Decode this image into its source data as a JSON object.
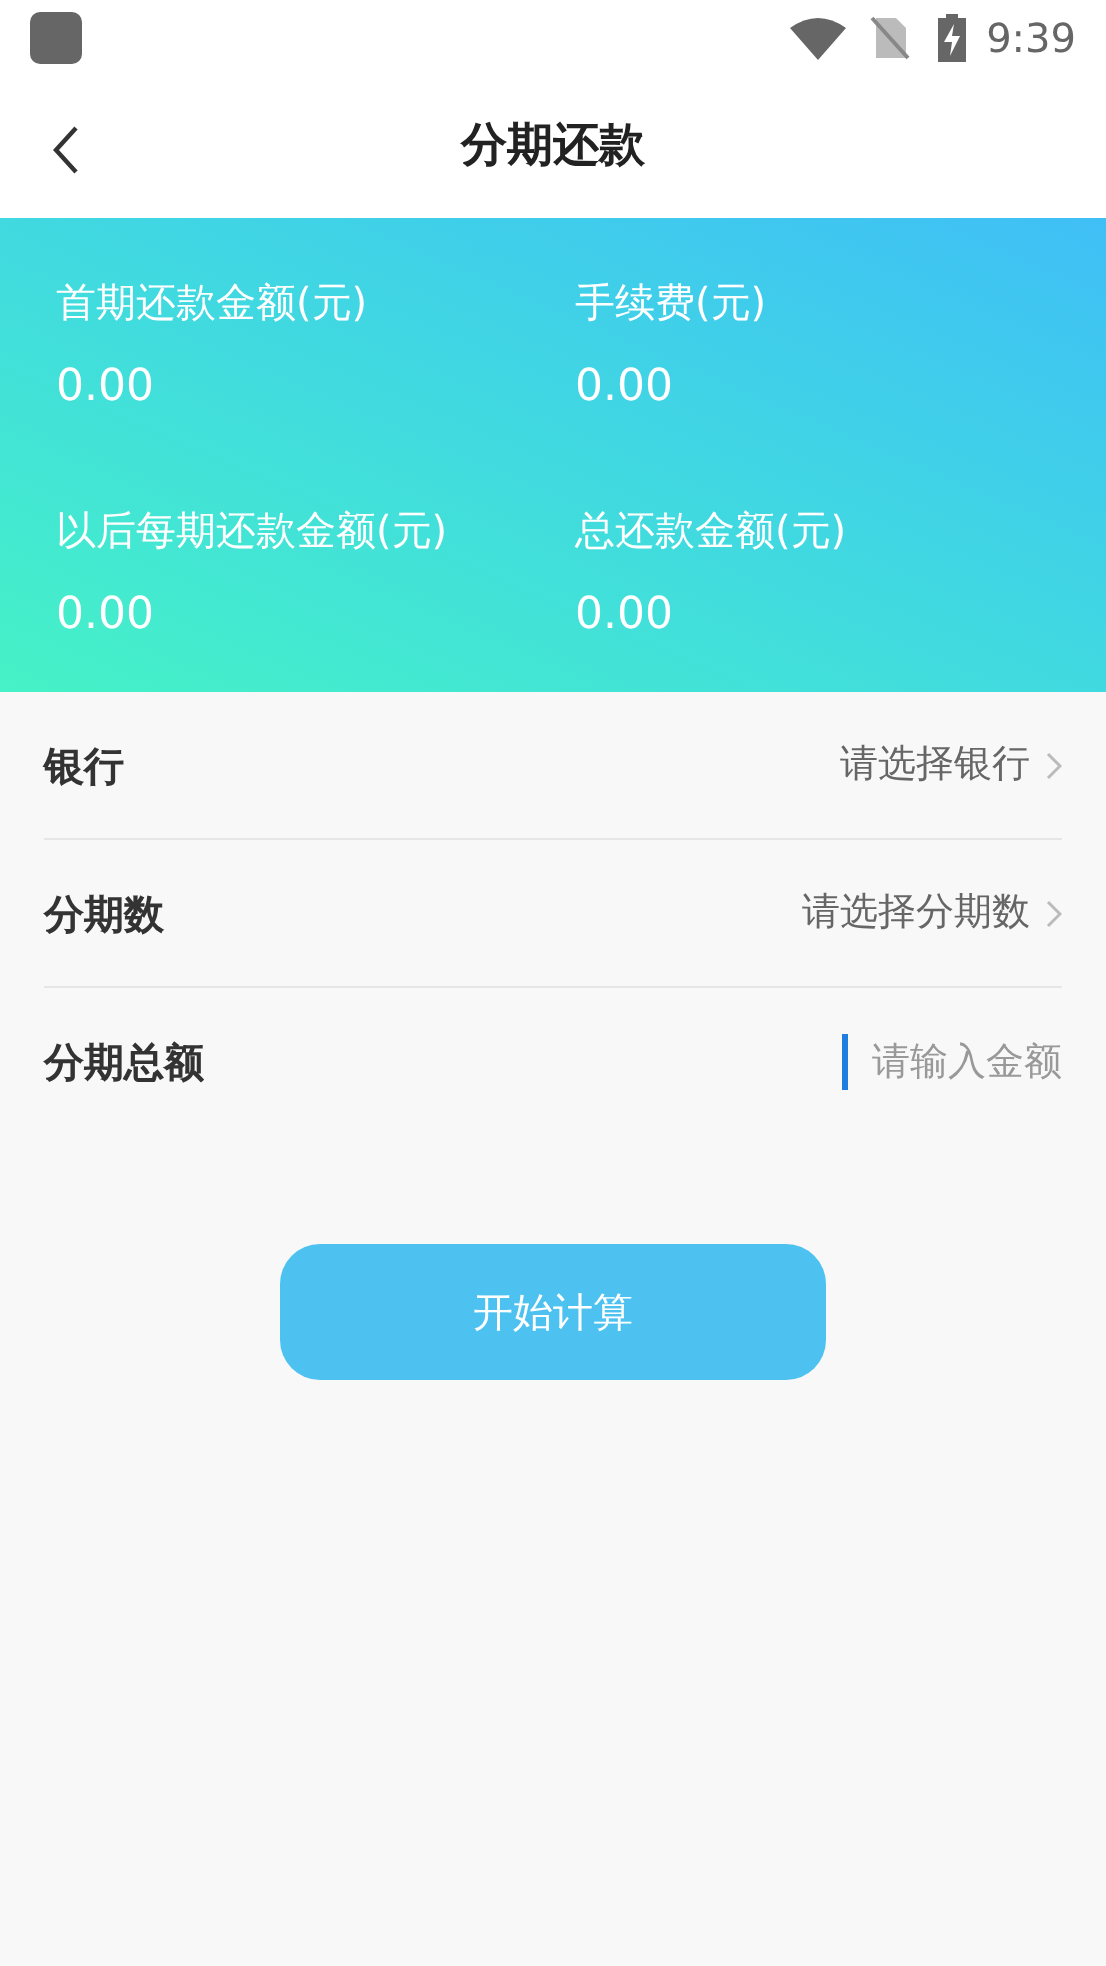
{
  "status_bar": {
    "time": "9:39"
  },
  "header": {
    "title": "分期还款"
  },
  "summary": [
    {
      "label": "首期还款金额(元)",
      "value": "0.00"
    },
    {
      "label": "手续费(元)",
      "value": "0.00"
    },
    {
      "label": "以后每期还款金额(元)",
      "value": "0.00"
    },
    {
      "label": "总还款金额(元)",
      "value": "0.00"
    }
  ],
  "form": [
    {
      "kind": "select",
      "label": "银行",
      "placeholder": "请选择银行"
    },
    {
      "kind": "select",
      "label": "分期数",
      "placeholder": "请选择分期数"
    },
    {
      "kind": "input",
      "label": "分期总额",
      "placeholder": "请输入金额"
    }
  ],
  "submit_button": "开始计算"
}
